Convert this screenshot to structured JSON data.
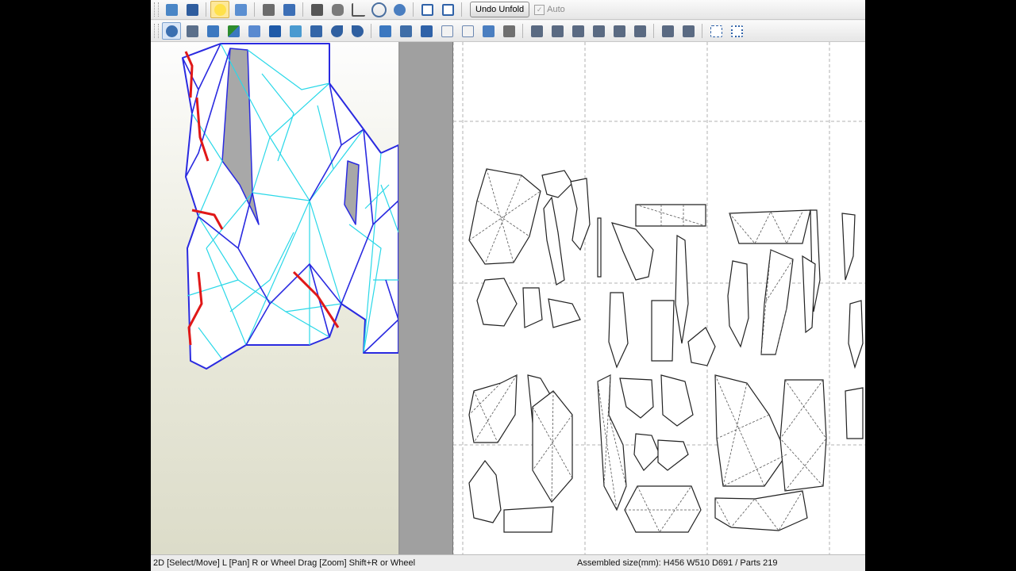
{
  "toolbar": {
    "undo_unfold_label": "Undo Unfold",
    "auto_label": "Auto",
    "auto_checked": true,
    "row1_icons": [
      "open-icon",
      "save-icon",
      "lightbulb-icon",
      "cubes-icon",
      "cube-icon",
      "box-icon",
      "cut-icon",
      "cylinder-icon",
      "axis-icon",
      "atom-icon",
      "connect-icon",
      "layout-split-icon",
      "window-icon"
    ],
    "row2_icons": [
      "select-icon",
      "rotate-icon",
      "join-icon",
      "edge-icon",
      "pencil-icon",
      "text-icon",
      "image-icon",
      "paint-icon",
      "undo-icon",
      "redo-icon",
      "book-icon",
      "collapse-icon",
      "flap-icon",
      "page-icon",
      "copy-icon",
      "clipboard-icon",
      "print-icon",
      "align-left-icon",
      "align-center-icon",
      "align-top-icon",
      "align-right-icon",
      "align-middle-icon",
      "align-bottom-icon",
      "flip-icon",
      "mirror-icon",
      "fit-icon",
      "frame-icon"
    ]
  },
  "status": {
    "left": "2D [Select/Move] L [Pan] R or Wheel Drag [Zoom] Shift+R or Wheel",
    "right": "Assembled size(mm): H456 W510 D691 / Parts 219"
  },
  "colors": {
    "mesh_outline": "#2a2ae0",
    "mesh_fold": "#2ad8e8",
    "mesh_cut": "#e01818",
    "mesh_fill": "#ffffff",
    "mesh_shadow": "#a8a8a8",
    "page_border": "#b0b0b0",
    "part_line": "#222222"
  }
}
